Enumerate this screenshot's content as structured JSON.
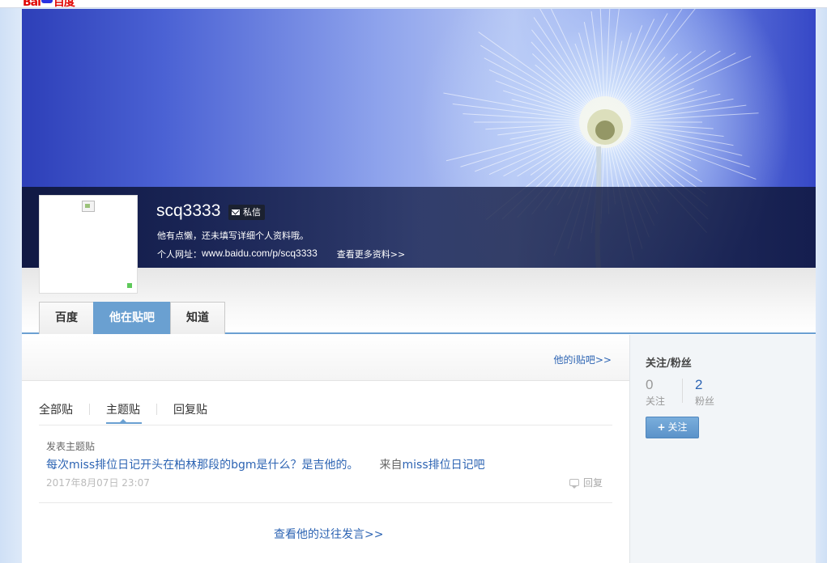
{
  "brand": {
    "logo_text": "Bai",
    "logo_suffix": "百度"
  },
  "profile": {
    "username": "scq3333",
    "pm_label": "私信",
    "intro": "他有点懒，还未填写详细个人资料哦。",
    "homepage_label": "个人网址：",
    "homepage_url": "www.baidu.com/p/scq3333",
    "more_info": "查看更多资料>>"
  },
  "tabs": [
    "百度",
    "他在贴吧",
    "知道"
  ],
  "main": {
    "ibar_link": "他的i贴吧>>",
    "content_tabs": [
      "全部贴",
      "主题贴",
      "回复贴"
    ],
    "post": {
      "type": "发表主题贴",
      "title": "每次miss排位日记开头在柏林那段的bgm是什么？是吉他的。",
      "from_label": "来自",
      "forum": "miss排位日记吧",
      "time": "2017年8月07日 23:07",
      "reply": "回复"
    },
    "history_link": "查看他的过往发言>>"
  },
  "sidebar": {
    "title": "关注/粉丝",
    "following_count": "0",
    "following_label": "关注",
    "fans_count": "2",
    "fans_label": "粉丝",
    "follow_button_plus": "+",
    "follow_button": "关注"
  },
  "colors": {
    "accent": "#6aa0d1",
    "link": "#2d64b3",
    "online": "#5ec95a"
  }
}
